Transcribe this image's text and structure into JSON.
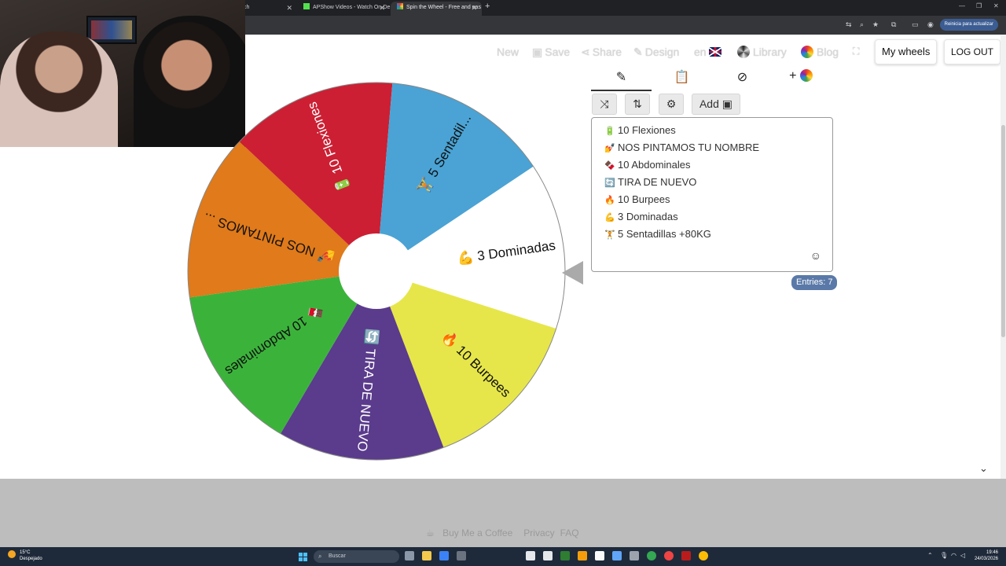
{
  "browser": {
    "tabs": [
      {
        "label": "tch",
        "favicon_color": "#9146ff",
        "active": false
      },
      {
        "label": "APShow Videos - Watch On-De",
        "favicon_color": "#53e04e",
        "active": false
      },
      {
        "label": "Spin the Wheel - Free and eas",
        "favicon_color": "#e53935",
        "active": true
      }
    ],
    "update_button": "Reinicia para actualizar"
  },
  "nav": {
    "new": "New",
    "save": "Save",
    "share": "Share",
    "design": "Design",
    "language": "en",
    "library": "Library",
    "blog": "Blog",
    "my_wheels": "My wheels",
    "logout": "LOG OUT"
  },
  "wheel": {
    "segments": [
      {
        "label": "3 Dominadas",
        "emoji": "💪",
        "color": "#ffffff",
        "text_color": "#111111"
      },
      {
        "label": "10 Burpees",
        "emoji": "🔥",
        "color": "#e6e64a",
        "text_color": "#111111"
      },
      {
        "label": "TIRA DE NUEVO",
        "emoji": "🔄",
        "color": "#5a3b8c",
        "text_color": "#ffffff"
      },
      {
        "label": "10 Abdominales",
        "emoji": "🍫",
        "color": "#3bb33b",
        "text_color": "#111111"
      },
      {
        "label": "NOS PINTAMOS ...",
        "emoji": "💅",
        "color": "#e07a1a",
        "text_color": "#111111"
      },
      {
        "label": "10 Flexiones",
        "emoji": "🔋",
        "color": "#cc1f33",
        "text_color": "#ffffff"
      },
      {
        "label": "5 Sentadil...",
        "emoji": "🏋",
        "color": "#4aa3d4",
        "text_color": "#111111"
      }
    ]
  },
  "editor": {
    "add_label": "Add",
    "entries": [
      {
        "emoji": "🔋",
        "text": "10 Flexiones"
      },
      {
        "emoji": "💅",
        "text": "NOS PINTAMOS TU NOMBRE"
      },
      {
        "emoji": "🍫",
        "text": "10 Abdominales"
      },
      {
        "emoji": "🔄",
        "text": "TIRA DE NUEVO"
      },
      {
        "emoji": "🔥",
        "text": "10 Burpees"
      },
      {
        "emoji": "💪",
        "text": "3 Dominadas"
      },
      {
        "emoji": "🏋",
        "text": "5 Sentadillas +80KG"
      }
    ],
    "count_label": "Entries: 7"
  },
  "footer": {
    "coffee": "Buy Me a Coffee",
    "privacy": "Privacy",
    "faq": "FAQ"
  },
  "taskbar": {
    "temperature": "15°C",
    "weather": "Despejado",
    "search": "Buscar",
    "time": "19:46",
    "date": "24/03/2026"
  }
}
